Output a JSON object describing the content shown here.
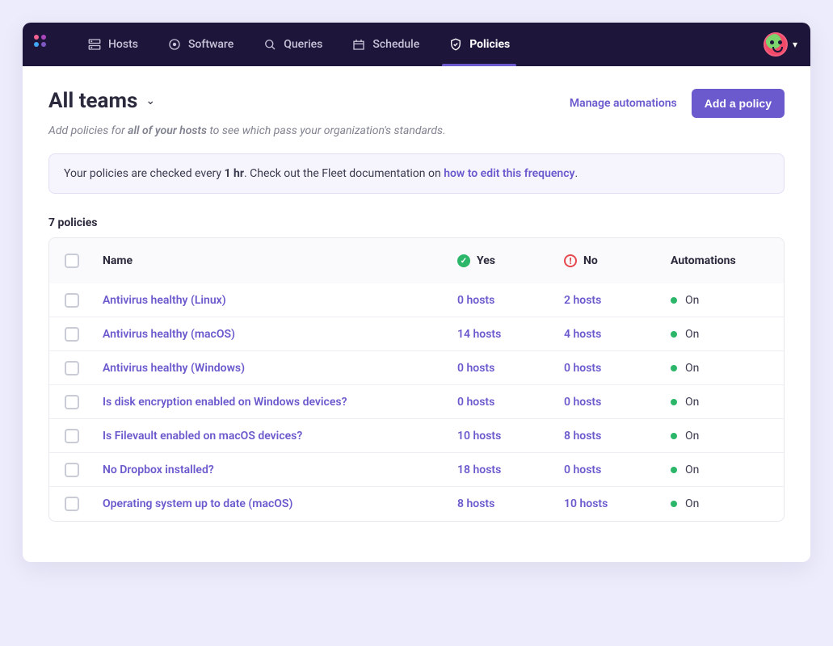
{
  "nav": {
    "items": [
      {
        "label": "Hosts"
      },
      {
        "label": "Software"
      },
      {
        "label": "Queries"
      },
      {
        "label": "Schedule"
      },
      {
        "label": "Policies"
      }
    ]
  },
  "header": {
    "title": "All teams",
    "subtitle_prefix": "Add policies for ",
    "subtitle_em": "all of your hosts",
    "subtitle_suffix": " to see which pass your organization's standards.",
    "manage_automations": "Manage automations",
    "add_policy": "Add a policy"
  },
  "banner": {
    "text_prefix": "Your policies are checked every ",
    "interval": "1 hr",
    "text_mid": ". Check out the Fleet documentation on ",
    "link": "how to edit this frequency",
    "text_suffix": "."
  },
  "count_label": "7 policies",
  "columns": {
    "name": "Name",
    "yes": "Yes",
    "no": "No",
    "automations": "Automations"
  },
  "policies": [
    {
      "name": "Antivirus healthy (Linux)",
      "yes": "0 hosts",
      "no": "2 hosts",
      "automation": "On"
    },
    {
      "name": "Antivirus healthy (macOS)",
      "yes": "14 hosts",
      "no": "4 hosts",
      "automation": "On"
    },
    {
      "name": "Antivirus healthy (Windows)",
      "yes": "0 hosts",
      "no": "0 hosts",
      "automation": "On"
    },
    {
      "name": "Is disk encryption enabled on Windows devices?",
      "yes": "0 hosts",
      "no": "0 hosts",
      "automation": "On"
    },
    {
      "name": "Is Filevault enabled on macOS devices?",
      "yes": "10 hosts",
      "no": "8 hosts",
      "automation": "On"
    },
    {
      "name": "No Dropbox installed?",
      "yes": "18 hosts",
      "no": "0 hosts",
      "automation": "On"
    },
    {
      "name": "Operating system up to date (macOS)",
      "yes": "8 hosts",
      "no": "10 hosts",
      "automation": "On"
    }
  ]
}
